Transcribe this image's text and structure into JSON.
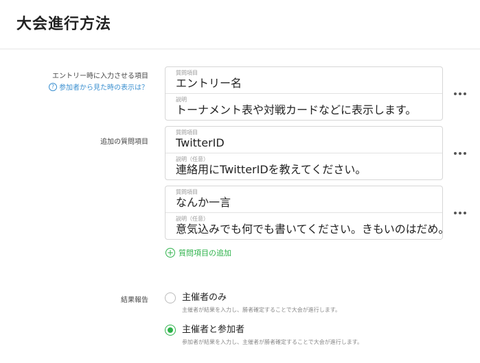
{
  "page": {
    "title": "大会進行方法"
  },
  "entry_section": {
    "label": "エントリー時に入力させる項目",
    "help_link": "参加者から見た時の表示は？",
    "question": {
      "question_label": "質問項目",
      "question_value": "エントリー名",
      "desc_label": "説明",
      "desc_value": "トーナメント表や対戦カードなどに表示します。"
    }
  },
  "additional_section": {
    "label": "追加の質問項目",
    "questions": [
      {
        "question_label": "質問項目",
        "question_value": "TwitterID",
        "desc_label": "説明（任意）",
        "desc_value": "連絡用にTwitterIDを教えてください。"
      },
      {
        "question_label": "質問項目",
        "question_value": "なんか一言",
        "desc_label": "説明（任意）",
        "desc_value": "意気込みでも何でも書いてください。きもいのはだめ。"
      }
    ],
    "add_button": "質問項目の追加"
  },
  "result_section": {
    "label": "結果報告",
    "options": [
      {
        "title": "主催者のみ",
        "desc": "主催者が結果を入力し、勝者確定することで大会が進行します。",
        "selected": false
      },
      {
        "title": "主催者と参加者",
        "desc": "参加者が結果を入力し、主催者が勝者確定することで大会が進行します。",
        "selected": true
      }
    ]
  },
  "icons": {
    "more": "more-horizontal-icon",
    "help": "question-circle-icon",
    "add": "plus-circle-icon"
  },
  "colors": {
    "accent": "#2db24a",
    "link": "#3a8fd0"
  }
}
